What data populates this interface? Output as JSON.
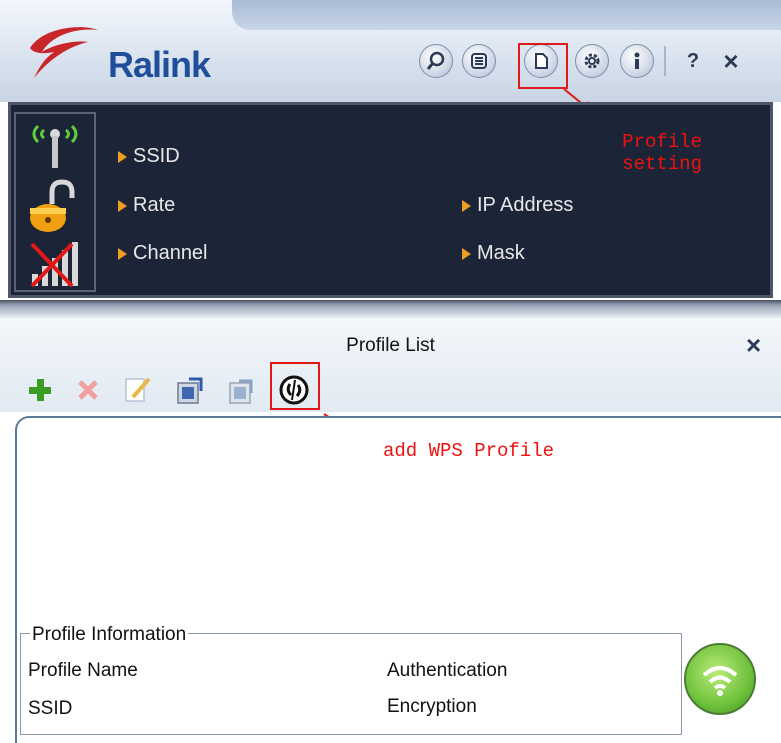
{
  "header": {
    "brand": "Ralink",
    "toolbar": {
      "buttons": [
        {
          "icon": "search-icon"
        },
        {
          "icon": "list-icon"
        },
        {
          "icon": "profile-page-icon"
        },
        {
          "icon": "gear-icon"
        },
        {
          "icon": "info-icon"
        }
      ],
      "help_label": "?",
      "close_label": "×"
    }
  },
  "status": {
    "icons": [
      "signal-antenna-icon",
      "padlock-open-icon",
      "signal-bars-crossed-icon"
    ],
    "fields": {
      "ssid": "SSID",
      "rate": "Rate",
      "channel": "Channel",
      "ip_address": "IP Address",
      "mask": "Mask"
    }
  },
  "annotations": {
    "profile_setting_line1": "Profile",
    "profile_setting_line2": "setting",
    "add_wps": "add WPS Profile"
  },
  "profile_list": {
    "title": "Profile List",
    "close_label": "×",
    "toolbar": [
      "add-icon",
      "delete-icon",
      "edit-icon",
      "import-icon",
      "export-icon",
      "wps-icon"
    ]
  },
  "profile_info": {
    "legend": "Profile Information",
    "profile_name": "Profile Name",
    "ssid": "SSID",
    "authentication": "Authentication",
    "encryption": "Encryption"
  },
  "colors": {
    "accent_red": "#e01818",
    "brand_blue": "#1f4f9a",
    "status_bg": "#1c2438",
    "bullet_orange": "#f0a020"
  }
}
